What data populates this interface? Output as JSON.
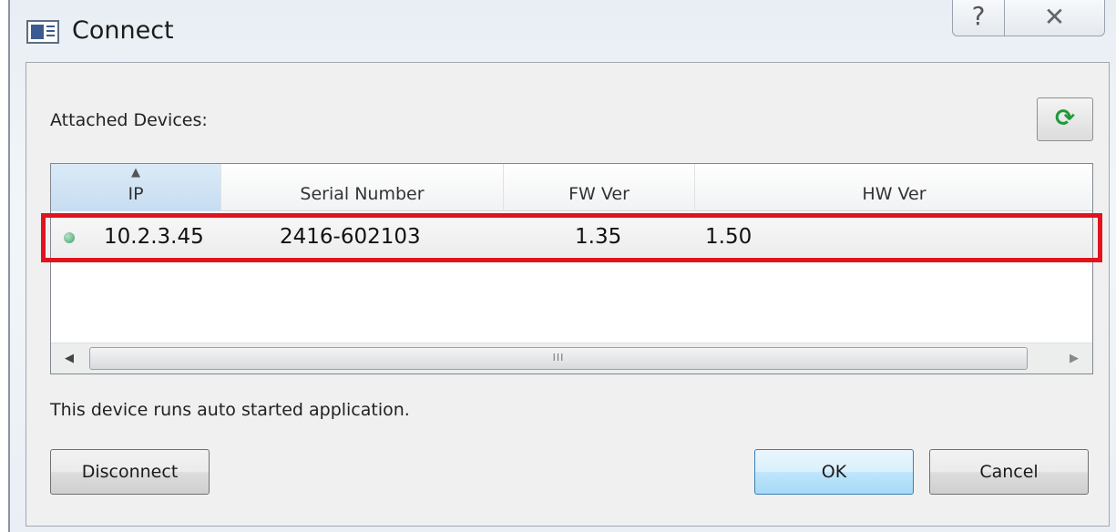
{
  "window": {
    "title": "Connect"
  },
  "caption": {
    "help_glyph": "?",
    "close_glyph": "✕"
  },
  "devices_label": "Attached Devices:",
  "refresh_icon": "refresh-icon",
  "table": {
    "columns": [
      "IP",
      "Serial Number",
      "FW Ver",
      "HW Ver"
    ],
    "sorted_column": "IP",
    "rows": [
      {
        "status": "connected",
        "ip": "10.2.3.45",
        "serial": "2416-602103",
        "fw": "1.35",
        "hw": "1.50"
      }
    ]
  },
  "scrollbar": {
    "thumb_grip": "III"
  },
  "status_message": "This device runs auto started application.",
  "buttons": {
    "disconnect": "Disconnect",
    "ok": "OK",
    "cancel": "Cancel"
  },
  "colors": {
    "highlight": "#e0141e",
    "status_dot": "#3e9e6a",
    "ok_border": "#3c7fb1"
  }
}
